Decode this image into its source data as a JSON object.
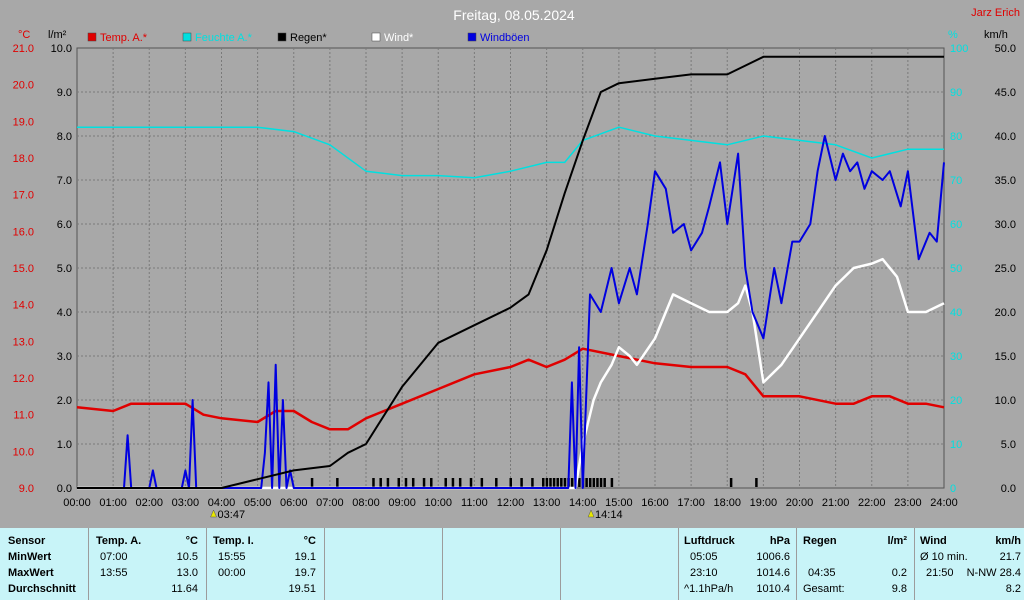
{
  "title": "Freitag, 08.05.2024",
  "credit": "Jarz Erich",
  "colors": {
    "temp": "#e00000",
    "humidity": "#00e0e0",
    "rain": "#000000",
    "wind": "#ffffff",
    "gusts": "#0000e0",
    "bg": "#a8a8a8",
    "grid": "#7a7a7a",
    "panel": "#c8f4f8"
  },
  "legend": [
    {
      "label": "Temp. A.*",
      "color": "#e00000"
    },
    {
      "label": "Feuchte A.*",
      "color": "#00e0e0"
    },
    {
      "label": "Regen*",
      "color": "#000000"
    },
    {
      "label": "Wind*",
      "color": "#ffffff"
    },
    {
      "label": "Windböen",
      "color": "#0000e0"
    }
  ],
  "axes": {
    "left_temp": {
      "unit": "°C",
      "ticks": [
        "9.0",
        "10.0",
        "11.0",
        "12.0",
        "13.0",
        "14.0",
        "15.0",
        "16.0",
        "17.0",
        "18.0",
        "19.0",
        "20.0",
        "21.0"
      ],
      "min": 9,
      "max": 21
    },
    "left_rain": {
      "unit": "l/m²",
      "ticks": [
        "0.0",
        "1.0",
        "2.0",
        "3.0",
        "4.0",
        "5.0",
        "6.0",
        "7.0",
        "8.0",
        "9.0",
        "10.0"
      ],
      "min": 0,
      "max": 10
    },
    "right_hum": {
      "unit": "%",
      "ticks": [
        "0",
        "10",
        "20",
        "30",
        "40",
        "50",
        "60",
        "70",
        "80",
        "90",
        "100"
      ],
      "min": 0,
      "max": 100
    },
    "right_wind": {
      "unit": "km/h",
      "ticks": [
        "0.0",
        "5.0",
        "10.0",
        "15.0",
        "20.0",
        "25.0",
        "30.0",
        "35.0",
        "40.0",
        "45.0",
        "50.0"
      ],
      "min": 0,
      "max": 50
    },
    "x_ticks": [
      "00:00",
      "01:00",
      "02:00",
      "03:00",
      "04:00",
      "05:00",
      "06:00",
      "07:00",
      "08:00",
      "09:00",
      "10:00",
      "11:00",
      "12:00",
      "13:00",
      "14:00",
      "15:00",
      "16:00",
      "17:00",
      "18:00",
      "19:00",
      "20:00",
      "21:00",
      "22:00",
      "23:00",
      "24:00"
    ]
  },
  "sun": {
    "sunrise": "03:47",
    "sunset": "14:14"
  },
  "chart_data": {
    "type": "line",
    "title": "Freitag, 08.05.2024",
    "x_unit": "h",
    "series": [
      {
        "name": "Temp. A.*",
        "axis": "°C",
        "x": [
          0,
          1,
          1.5,
          2,
          3,
          3.5,
          4,
          5,
          5.5,
          6,
          6.5,
          7,
          7.5,
          8,
          9,
          10,
          11,
          12,
          12.5,
          13,
          13.5,
          14,
          15,
          16,
          17,
          18,
          18.5,
          19,
          20,
          21,
          21.5,
          22,
          22.5,
          23,
          23.5,
          24
        ],
        "values": [
          11.2,
          11.1,
          11.3,
          11.3,
          11.3,
          11.0,
          10.9,
          10.8,
          11.1,
          11.1,
          10.8,
          10.6,
          10.6,
          10.9,
          11.3,
          11.7,
          12.1,
          12.3,
          12.5,
          12.3,
          12.5,
          12.8,
          12.6,
          12.4,
          12.3,
          12.3,
          12.1,
          11.5,
          11.5,
          11.3,
          11.3,
          11.5,
          11.5,
          11.3,
          11.3,
          11.2
        ]
      },
      {
        "name": "Feuchte A.*",
        "axis": "%",
        "x": [
          0,
          1,
          2,
          3,
          4,
          5,
          6,
          7,
          8,
          9,
          10,
          11,
          12,
          13,
          13.5,
          14,
          15,
          16,
          17,
          18,
          19,
          20,
          21,
          22,
          23,
          24
        ],
        "values": [
          82,
          82,
          82,
          82,
          82,
          82,
          81,
          78,
          72,
          71,
          71,
          70.5,
          72,
          74,
          74,
          79,
          82,
          80,
          79,
          78,
          80,
          79,
          78,
          75,
          77,
          77
        ]
      },
      {
        "name": "Regen*",
        "axis": "l/m²",
        "x": [
          0,
          4,
          5,
          6,
          7,
          7.5,
          8,
          9,
          10,
          11,
          12,
          12.5,
          13,
          13.5,
          14,
          14.5,
          15,
          16,
          17,
          18,
          18.5,
          19,
          20,
          24
        ],
        "values": [
          0,
          0,
          0.2,
          0.4,
          0.5,
          0.8,
          1.0,
          2.3,
          3.3,
          3.7,
          4.1,
          4.4,
          5.4,
          6.7,
          7.9,
          9.0,
          9.2,
          9.3,
          9.4,
          9.4,
          9.6,
          9.8,
          9.8,
          9.8
        ]
      },
      {
        "name": "Wind*",
        "axis": "km/h",
        "x": [
          0,
          13.8,
          14,
          14.3,
          14.5,
          14.8,
          15,
          15.3,
          15.5,
          16,
          16.5,
          17,
          17.5,
          18,
          18.3,
          18.5,
          18.7,
          19,
          19.5,
          20,
          20.5,
          21,
          21.5,
          22,
          22.3,
          22.7,
          23,
          23.5,
          24
        ],
        "values": [
          0,
          0,
          5,
          10,
          12,
          14,
          16,
          15,
          14,
          17,
          22,
          21,
          20,
          20,
          21,
          23,
          20,
          12,
          14,
          17,
          20,
          23,
          25,
          25.5,
          26,
          24,
          20,
          20,
          21
        ]
      },
      {
        "name": "Windböen",
        "axis": "km/h",
        "x": [
          0,
          1.3,
          1.4,
          1.5,
          2.0,
          2.1,
          2.2,
          2.9,
          3.0,
          3.1,
          3.2,
          3.3,
          5.1,
          5.2,
          5.3,
          5.4,
          5.5,
          5.6,
          5.7,
          5.8,
          5.9,
          6.0,
          13.6,
          13.7,
          13.8,
          13.9,
          14.0,
          14.2,
          14.5,
          14.8,
          15.0,
          15.3,
          15.5,
          15.8,
          16.0,
          16.3,
          16.5,
          16.8,
          17.0,
          17.3,
          17.5,
          17.8,
          18.0,
          18.3,
          18.5,
          18.7,
          19.0,
          19.3,
          19.5,
          19.8,
          20.0,
          20.3,
          20.5,
          20.7,
          21.0,
          21.2,
          21.4,
          21.6,
          21.8,
          22.0,
          22.3,
          22.5,
          22.8,
          23.0,
          23.3,
          23.6,
          23.8,
          24
        ],
        "values": [
          0,
          0,
          6,
          0,
          0,
          2,
          0,
          0,
          2,
          0,
          10,
          0,
          0,
          4,
          12,
          0,
          14,
          0,
          10,
          0,
          2,
          0,
          0,
          12,
          0,
          16,
          0,
          22,
          20,
          25,
          21,
          25,
          22,
          30,
          36,
          34,
          29,
          30,
          27,
          29,
          32,
          37,
          30,
          38,
          25,
          20,
          17,
          25,
          21,
          28,
          28,
          30,
          36,
          40,
          35,
          38,
          36,
          37,
          34,
          36,
          35,
          36,
          32,
          36,
          26,
          29,
          28,
          37
        ]
      }
    ],
    "rain_marks": [
      6.5,
      7.2,
      8.2,
      8.4,
      8.6,
      8.9,
      9.1,
      9.3,
      9.6,
      9.8,
      10.2,
      10.4,
      10.6,
      10.9,
      11.2,
      11.6,
      12.0,
      12.3,
      12.6,
      12.9,
      13.0,
      13.1,
      13.2,
      13.3,
      13.4,
      13.5,
      13.6,
      13.7,
      13.8,
      13.9,
      14.0,
      14.1,
      14.2,
      14.3,
      14.4,
      14.5,
      14.6,
      14.8,
      18.1,
      18.8
    ]
  },
  "table": {
    "sensor": {
      "head": "Sensor",
      "rows": [
        "MinWert",
        "MaxWert",
        "Durchschnitt"
      ]
    },
    "temp_a": {
      "head": "Temp. A.",
      "unit": "°C",
      "rows": [
        [
          "07:00",
          "10.5"
        ],
        [
          "13:55",
          "13.0"
        ],
        [
          "",
          "11.64"
        ]
      ]
    },
    "temp_i": {
      "head": "Temp. I.",
      "unit": "°C",
      "rows": [
        [
          "15:55",
          "19.1"
        ],
        [
          "00:00",
          "19.7"
        ],
        [
          "",
          "19.51"
        ]
      ]
    },
    "pressure": {
      "head": "Luftdruck",
      "unit": "hPa",
      "rows": [
        [
          "05:05",
          "1006.6"
        ],
        [
          "23:10",
          "1014.6"
        ],
        [
          "^1.1hPa/h",
          "1010.4"
        ]
      ]
    },
    "rain": {
      "head": "Regen",
      "unit": "l/m²",
      "rows": [
        [
          "",
          ""
        ],
        [
          "04:35",
          "0.2"
        ],
        [
          "Gesamt:",
          "9.8"
        ]
      ]
    },
    "wind": {
      "head": "Wind",
      "unit": "km/h",
      "rows": [
        [
          "Ø 10 min.",
          "21.7"
        ],
        [
          "21:50",
          "N-NW 28.4"
        ],
        [
          "",
          "8.2"
        ]
      ]
    }
  }
}
